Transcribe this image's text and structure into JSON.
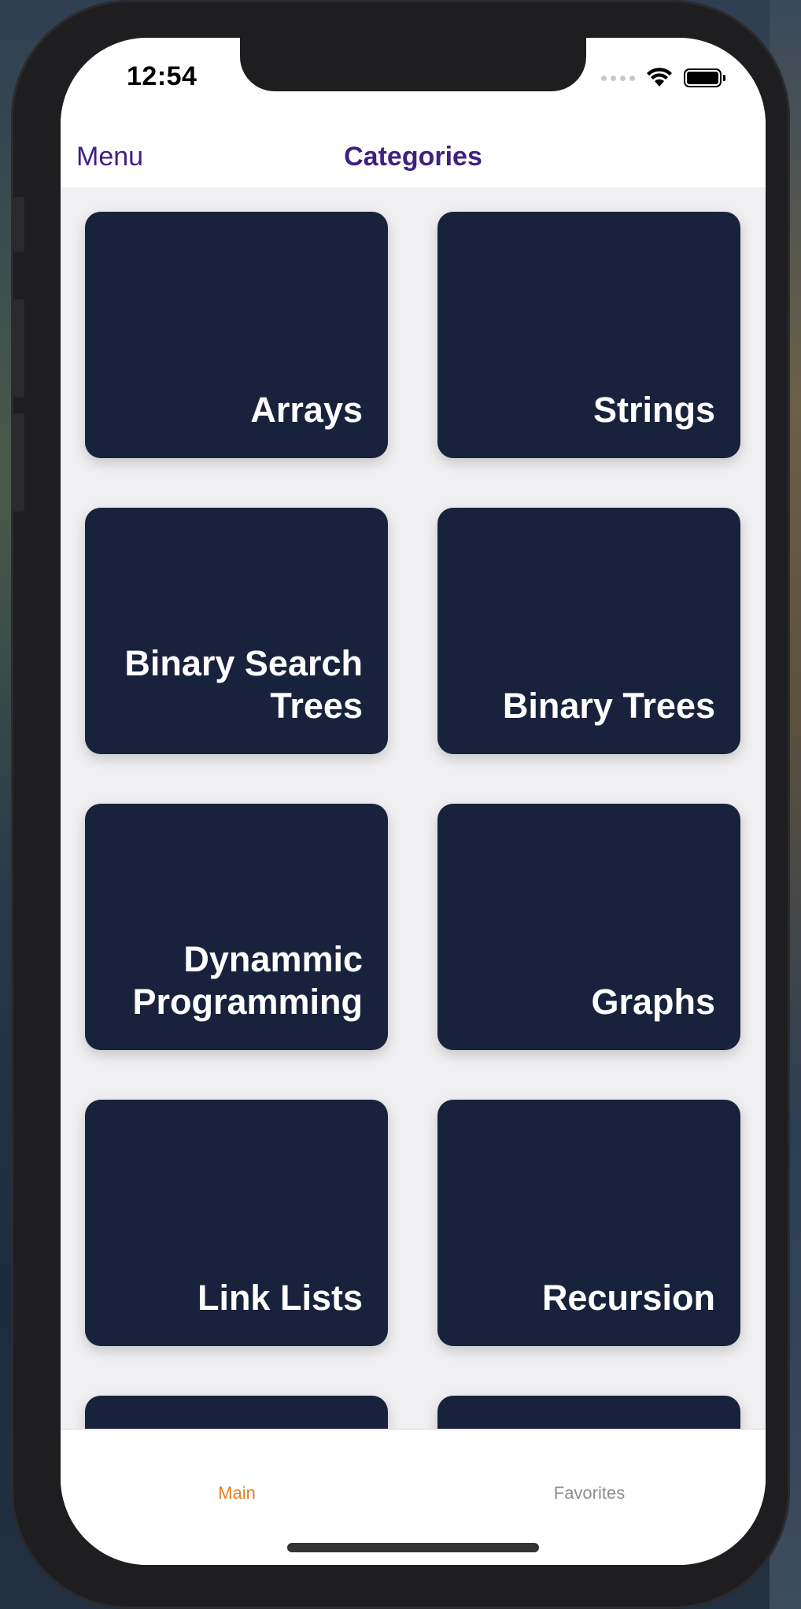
{
  "status_bar": {
    "time": "12:54"
  },
  "nav": {
    "menu_label": "Menu",
    "title": "Categories"
  },
  "categories": [
    {
      "label": "Arrays"
    },
    {
      "label": "Strings"
    },
    {
      "label": "Binary Search Trees"
    },
    {
      "label": "Binary Trees"
    },
    {
      "label": "Dynammic Programming"
    },
    {
      "label": "Graphs"
    },
    {
      "label": "Link Lists"
    },
    {
      "label": "Recursion"
    }
  ],
  "tab_bar": {
    "main_label": "Main",
    "favorites_label": "Favorites",
    "active_color": "#e67e22",
    "inactive_color": "#8e8e93"
  },
  "colors": {
    "accent": "#3e2182",
    "card_background": "#19223d"
  },
  "icons": [
    "cellular-signal-icon",
    "wifi-icon",
    "battery-icon"
  ]
}
